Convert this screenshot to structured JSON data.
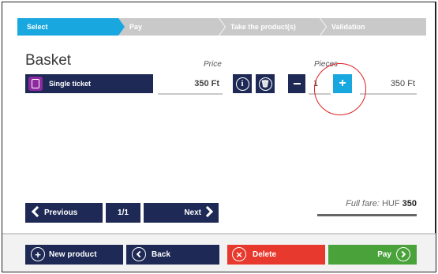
{
  "steps": [
    "Select",
    "Pay",
    "Take the product(s)",
    "Validation"
  ],
  "basket": {
    "title": "Basket",
    "price_header": "Price",
    "pieces_header": "Pieces"
  },
  "item": {
    "name": "Single ticket",
    "price": "350 Ft",
    "info_glyph": "i",
    "trash_glyph": "🗑",
    "quantity": "1",
    "plus_glyph": "+",
    "total": "350 Ft"
  },
  "pagination": {
    "previous": "Previous",
    "page": "1/1",
    "next": "Next"
  },
  "fare": {
    "label": "Full fare:",
    "currency": "HUF",
    "amount": "350"
  },
  "actions": {
    "new_product": "New product",
    "back": "Back",
    "delete": "Delete",
    "pay": "Pay",
    "plus_glyph": "+",
    "delete_glyph": "×"
  },
  "colors": {
    "active_step": "#19a7e0",
    "inactive_step": "#c9c9c9",
    "navy": "#1e2a55",
    "ticket_icon": "#8e2aa0",
    "delete": "#e8392e",
    "pay": "#4aa33a",
    "highlight": "#e02020"
  }
}
